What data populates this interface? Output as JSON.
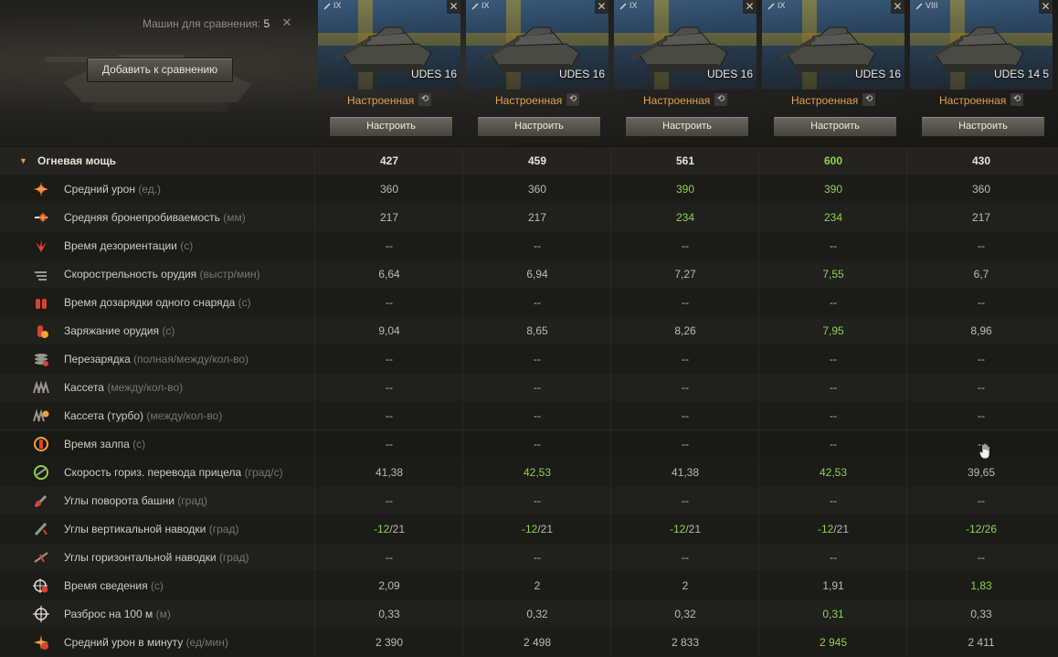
{
  "compare": {
    "count_label": "Машин для сравнения:",
    "count_value": "5",
    "clear_icon": "close-icon",
    "add_button": "Добавить к сравнению"
  },
  "tanks": [
    {
      "tier": "IX",
      "name": "UDES 16",
      "state": "Настроенная",
      "button": "Настроить"
    },
    {
      "tier": "IX",
      "name": "UDES 16",
      "state": "Настроенная",
      "button": "Настроить"
    },
    {
      "tier": "IX",
      "name": "UDES 16",
      "state": "Настроенная",
      "button": "Настроить"
    },
    {
      "tier": "IX",
      "name": "UDES 16",
      "state": "Настроенная",
      "button": "Настроить"
    },
    {
      "tier": "VIII",
      "name": "UDES 14 5",
      "state": "Настроенная",
      "button": "Настроить"
    }
  ],
  "section": {
    "title": "Огневая мощь",
    "values": [
      "427",
      "459",
      "561",
      "600",
      "430"
    ],
    "best": [
      false,
      false,
      false,
      true,
      false
    ]
  },
  "rows": [
    {
      "icon": "damage-icon",
      "label": "Средний урон",
      "unit": "(ед.)",
      "values": [
        "360",
        "360",
        "390",
        "390",
        "360"
      ],
      "best": [
        false,
        false,
        true,
        true,
        false
      ]
    },
    {
      "icon": "penetration-icon",
      "label": "Средняя бронепробиваемость",
      "unit": "(мм)",
      "values": [
        "217",
        "217",
        "234",
        "234",
        "217"
      ],
      "best": [
        false,
        false,
        true,
        true,
        false
      ]
    },
    {
      "icon": "stun-icon",
      "label": "Время дезориентации",
      "unit": "(с)",
      "values": [
        "--",
        "--",
        "--",
        "--",
        "--"
      ],
      "best": [
        false,
        false,
        false,
        false,
        false
      ]
    },
    {
      "icon": "rate-of-fire-icon",
      "label": "Скорострельность орудия",
      "unit": "(выстр/мин)",
      "values": [
        "6,64",
        "6,94",
        "7,27",
        "7,55",
        "6,7"
      ],
      "best": [
        false,
        false,
        false,
        true,
        false
      ]
    },
    {
      "icon": "shell-reload-icon",
      "label": "Время дозарядки одного снаряда",
      "unit": "(с)",
      "values": [
        "--",
        "--",
        "--",
        "--",
        "--"
      ],
      "best": [
        false,
        false,
        false,
        false,
        false
      ]
    },
    {
      "icon": "reload-icon",
      "label": "Заряжание орудия",
      "unit": "(с)",
      "values": [
        "9,04",
        "8,65",
        "8,26",
        "7,95",
        "8,96"
      ],
      "best": [
        false,
        false,
        false,
        true,
        false
      ]
    },
    {
      "icon": "autoreload-icon",
      "label": "Перезарядка",
      "unit": "(полная/между/кол-во)",
      "values": [
        "--",
        "--",
        "--",
        "--",
        "--"
      ],
      "best": [
        false,
        false,
        false,
        false,
        false
      ]
    },
    {
      "icon": "clip-icon",
      "label": "Кассета",
      "unit": "(между/кол-во)",
      "values": [
        "--",
        "--",
        "--",
        "--",
        "--"
      ],
      "best": [
        false,
        false,
        false,
        false,
        false
      ]
    },
    {
      "icon": "clip-turbo-icon",
      "label": "Кассета (турбо)",
      "unit": "(между/кол-во)",
      "values": [
        "--",
        "--",
        "--",
        "--",
        "--"
      ],
      "best": [
        false,
        false,
        false,
        false,
        false
      ]
    },
    {
      "icon": "salvo-icon",
      "label": "Время залпа",
      "unit": "(с)",
      "values": [
        "--",
        "--",
        "--",
        "--",
        "--"
      ],
      "best": [
        false,
        false,
        false,
        false,
        false
      ]
    },
    {
      "icon": "traverse-icon",
      "label": "Скорость гориз. перевода прицела",
      "unit": "(град/с)",
      "values": [
        "41,38",
        "42,53",
        "41,38",
        "42,53",
        "39,65"
      ],
      "best": [
        false,
        true,
        false,
        true,
        false
      ]
    },
    {
      "icon": "turret-angles-icon",
      "label": "Углы поворота башни",
      "unit": "(град)",
      "values": [
        "--",
        "--",
        "--",
        "--",
        "--"
      ],
      "best": [
        false,
        false,
        false,
        false,
        false
      ]
    },
    {
      "icon": "elevation-icon",
      "label": "Углы вертикальной наводки",
      "unit": "(град)",
      "values": [
        "-12/21",
        "-12/21",
        "-12/21",
        "-12/21",
        "-12/26"
      ],
      "best": [
        false,
        false,
        false,
        false,
        false
      ]
    },
    {
      "icon": "horizontal-angles-icon",
      "label": "Углы горизонтальной наводки",
      "unit": "(град)",
      "values": [
        "--",
        "--",
        "--",
        "--",
        "--"
      ],
      "best": [
        false,
        false,
        false,
        false,
        false
      ]
    },
    {
      "icon": "aim-time-icon",
      "label": "Время сведения",
      "unit": "(с)",
      "values": [
        "2,09",
        "2",
        "2",
        "1,91",
        "1,83"
      ],
      "best": [
        false,
        false,
        false,
        false,
        true
      ]
    },
    {
      "icon": "dispersion-icon",
      "label": "Разброс на 100 м",
      "unit": "(м)",
      "values": [
        "0,33",
        "0,32",
        "0,32",
        "0,31",
        "0,33"
      ],
      "best": [
        false,
        false,
        false,
        true,
        false
      ]
    },
    {
      "icon": "dpm-icon",
      "label": "Средний урон в минуту",
      "unit": "(ед/мин)",
      "values": [
        "2 390",
        "2 498",
        "2 833",
        "2 945",
        "2 411"
      ],
      "best": [
        false,
        false,
        false,
        true,
        false
      ]
    }
  ],
  "colors": {
    "best": "#8fd24a",
    "state": "#e0a24a"
  }
}
